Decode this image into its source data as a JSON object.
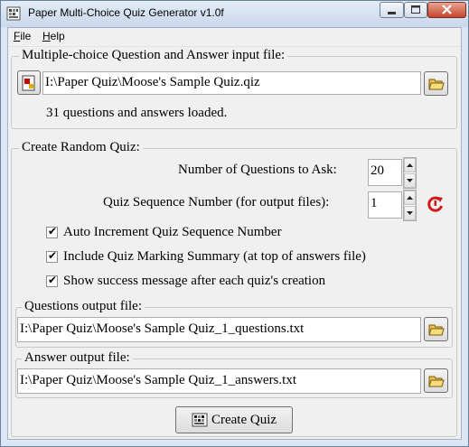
{
  "window": {
    "title": "Paper Multi-Choice Quiz Generator v1.0f"
  },
  "menu": {
    "file": {
      "u": "F",
      "rest": "ile"
    },
    "help": {
      "u": "H",
      "rest": "elp"
    }
  },
  "input_group": {
    "legend": "Multiple-choice Question and Answer input file:",
    "path": "I:\\Paper Quiz\\Moose's Sample Quiz.qiz",
    "status": "31 questions and answers loaded."
  },
  "quiz_group": {
    "legend": "Create Random Quiz:",
    "num_questions_label": "Number of Questions to Ask:",
    "num_questions_value": "20",
    "sequence_label": "Quiz Sequence Number (for output files):",
    "sequence_value": "1",
    "options": [
      {
        "label": "Auto Increment Quiz Sequence Number",
        "checked": true
      },
      {
        "label": "Include Quiz Marking Summary (at top of answers file)",
        "checked": true
      },
      {
        "label": "Show success message after each quiz's creation",
        "checked": true
      }
    ],
    "questions_output": {
      "legend": "Questions output file:",
      "path": "I:\\Paper Quiz\\Moose's Sample Quiz_1_questions.txt"
    },
    "answer_output": {
      "legend": "Answer output file:",
      "path": "I:\\Paper Quiz\\Moose's Sample Quiz_1_answers.txt"
    },
    "create_button": "Create Quiz"
  }
}
